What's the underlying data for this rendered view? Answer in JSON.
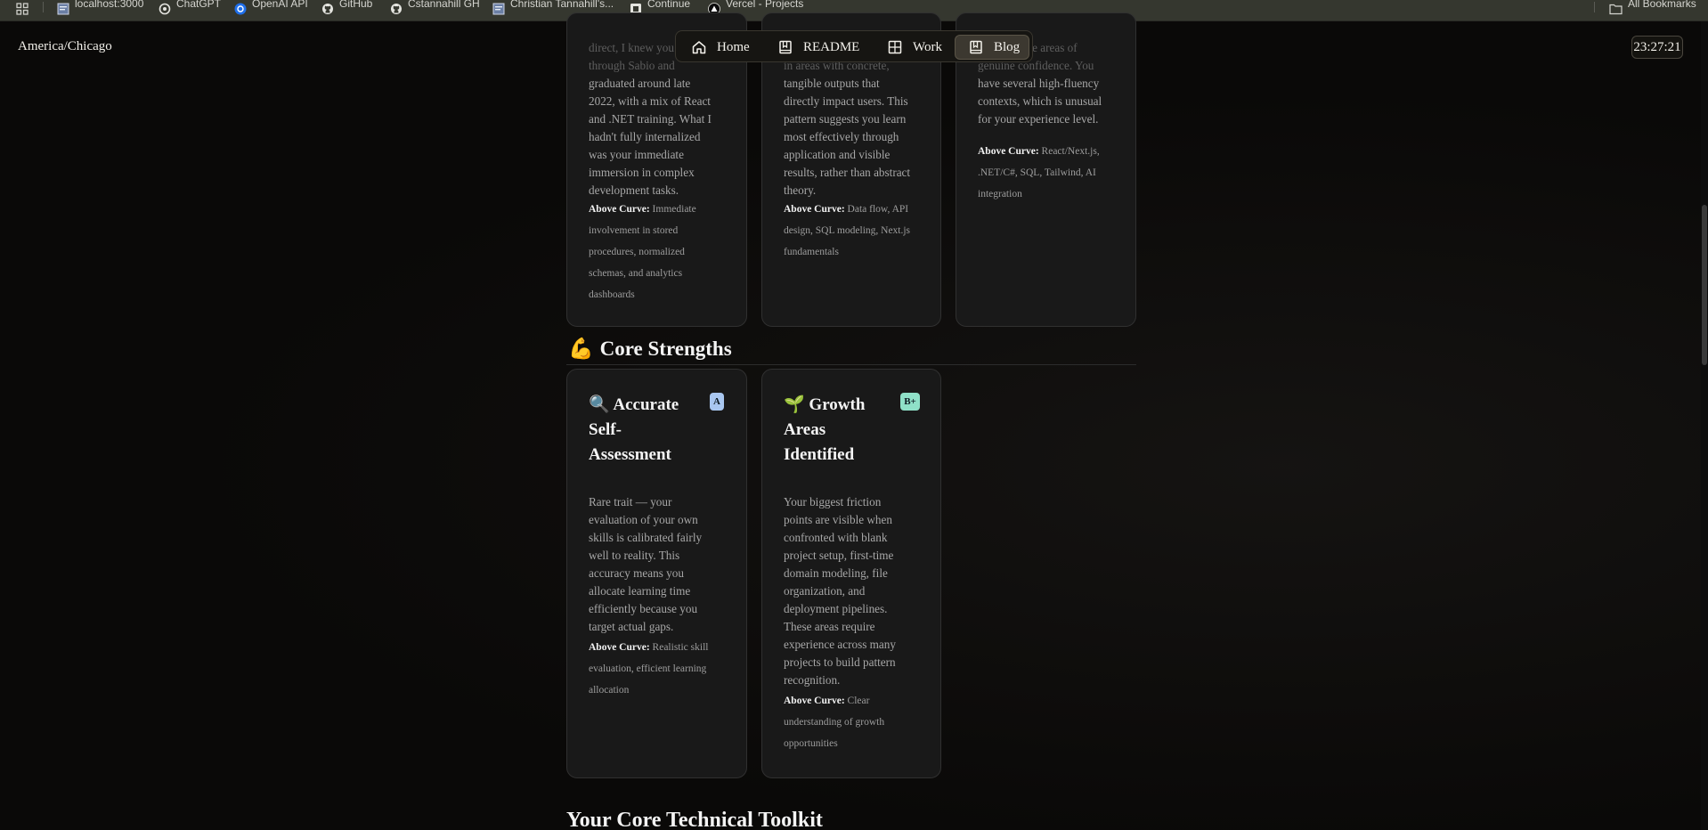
{
  "bookmarks": {
    "items": [
      {
        "label": "localhost:3000",
        "icon": "page-icon"
      },
      {
        "label": "ChatGPT",
        "icon": "chatgpt-icon"
      },
      {
        "label": "OpenAI API",
        "icon": "openai-icon"
      },
      {
        "label": "GitHub",
        "icon": "github-icon"
      },
      {
        "label": "Cstannahill GH",
        "icon": "github-icon"
      },
      {
        "label": "Christian Tannahill's...",
        "icon": "page-icon"
      },
      {
        "label": "Continue",
        "icon": "continue-icon"
      },
      {
        "label": "Vercel - Projects",
        "icon": "vercel-icon"
      }
    ],
    "all_bookmarks": "All Bookmarks"
  },
  "header": {
    "timezone": "America/Chicago",
    "clock": "23:27:21",
    "nav": [
      {
        "label": "Home",
        "icon": "home-icon",
        "active": false
      },
      {
        "label": "README",
        "icon": "book-icon",
        "active": false
      },
      {
        "label": "Work",
        "icon": "grid-icon",
        "active": false
      },
      {
        "label": "Blog",
        "icon": "book-icon",
        "active": true
      }
    ]
  },
  "top_cards": [
    {
      "partial_lines": [
        "direct, I knew you",
        "through Sabio and"
      ],
      "lines": [
        "graduated around late",
        "2022, with a mix of React",
        "and .NET training. What I",
        "hadn't fully internalized",
        "was your immediate",
        "immersion in complex",
        "development tasks."
      ],
      "curve_label": "Above Curve:",
      "curve_lines": [
        "Immediate",
        "involvement in stored",
        "procedures, normalized",
        "schemas, and analytics",
        "dashboards"
      ]
    },
    {
      "partial_lines": [
        "in areas with concrete,"
      ],
      "lines": [
        "tangible outputs that",
        "directly impact users. This",
        "pattern suggests you learn",
        "most effectively through",
        "application and visible",
        "results, rather than abstract",
        "theory."
      ],
      "curve_label": "Above Curve:",
      "curve_lines": [
        "Data flow, API",
        "design, SQL modeling, Next.js",
        "fundamentals"
      ]
    },
    {
      "partial_lines": [
        "have notable areas of",
        "genuine confidence. You"
      ],
      "lines": [
        "have several high-fluency",
        "contexts, which is unusual",
        "for your experience level."
      ],
      "curve_label": "Above Curve:",
      "curve_lines": [
        "React/Next.js,",
        ".NET/C#, SQL, Tailwind, AI",
        "integration"
      ]
    }
  ],
  "core_strengths": {
    "emoji": "💪",
    "title": "Core Strengths",
    "cards": [
      {
        "emoji": "🔍",
        "title_lines": [
          "Accurate",
          "Self-",
          "Assessment"
        ],
        "badge": "A",
        "badge_color": "#a9c7f0",
        "lines": [
          "Rare trait — your",
          "evaluation of your own",
          "skills is calibrated fairly",
          "well to reality. This",
          "accuracy means you",
          "allocate learning time",
          "efficiently because you",
          "target actual gaps."
        ],
        "curve_label": "Above Curve:",
        "curve_lines": [
          "Realistic skill",
          "evaluation, efficient learning",
          "allocation"
        ]
      },
      {
        "emoji": "🌱",
        "title_lines": [
          "Growth",
          "Areas",
          "Identified"
        ],
        "badge": "B+",
        "badge_color": "#8fe0c8",
        "lines": [
          "Your biggest friction",
          "points are visible when",
          "confronted with blank",
          "project setup, first-time",
          "domain modeling, file",
          "organization, and",
          "deployment pipelines.",
          "These areas require",
          "experience across many",
          "projects to build pattern",
          "recognition."
        ],
        "curve_label": "Above Curve:",
        "curve_lines": [
          "Clear",
          "understanding of growth",
          "opportunities"
        ]
      }
    ]
  },
  "toolkit_heading": "Your Core Technical Toolkit"
}
